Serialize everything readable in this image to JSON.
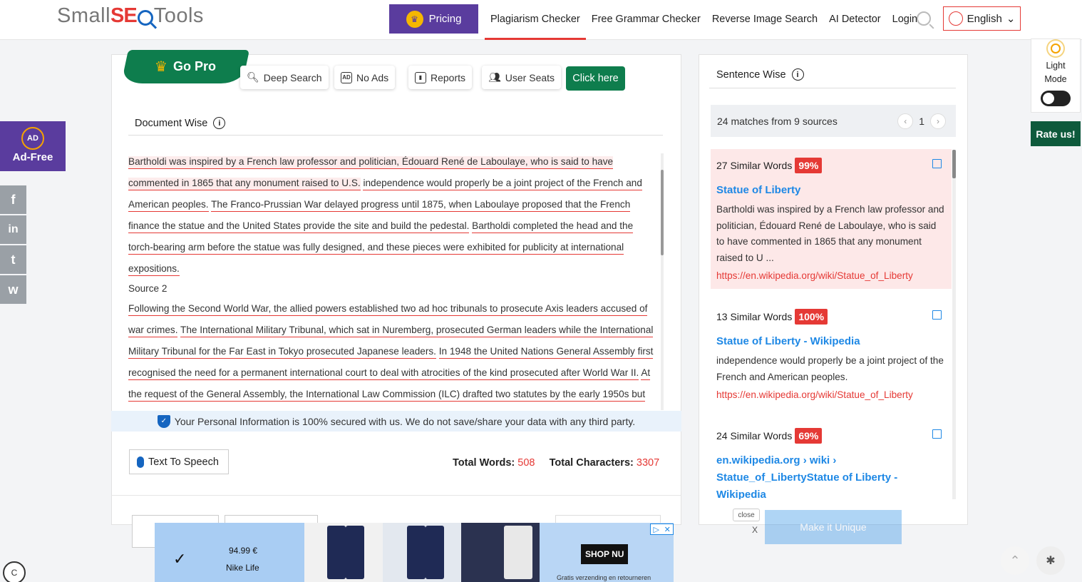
{
  "header": {
    "logo_small": "Small",
    "logo_seo": "SE",
    "logo_tools": "Tools",
    "pricing_label": "Pricing",
    "nav": [
      "Plagiarism Checker",
      "Free Grammar Checker",
      "Reverse Image Search",
      "AI Detector",
      "Login"
    ],
    "language": "English"
  },
  "pro_bar": {
    "go_pro": "Go Pro",
    "features": [
      {
        "label": "Deep Search",
        "icon": "search-icon"
      },
      {
        "label": "No Ads",
        "icon": "ad-block-icon"
      },
      {
        "label": "Reports",
        "icon": "report-icon"
      },
      {
        "label": "User Seats",
        "icon": "users-icon"
      }
    ],
    "cta": "Click here"
  },
  "document": {
    "heading": "Document Wise",
    "lines": [
      {
        "text": "Bartholdi was inspired by a French law professor and politician, Édouard René de Laboulaye, who is said to have commented in 1865 that any monument raised to U.S.",
        "type": "hl"
      },
      {
        "text": "independence would properly be a joint project of the French and American peoples.",
        "type": "u"
      },
      {
        "text": "The Franco-Prussian War delayed progress until 1875, when Laboulaye proposed that the French finance the statue and the United States provide the site and build the pedestal.",
        "type": "u"
      },
      {
        "text": "Bartholdi completed the head and the torch-bearing arm before the statue was fully designed, and these pieces were exhibited for publicity at international expositions.",
        "type": "u"
      }
    ],
    "source_label": "Source 2",
    "lines2": [
      "Following the Second World War, the allied powers established two ad hoc tribunals to prosecute Axis leaders accused of war crimes.",
      "The International Military Tribunal, which sat in Nuremberg, prosecuted German leaders while the International Military Tribunal for the Far East in Tokyo prosecuted Japanese leaders.",
      "In 1948 the United Nations General Assembly first recognised the need for a permanent international court to deal with atrocities of the kind prosecuted after World War II.",
      "At the request of the General Assembly, the International Law Commission (ILC) drafted two statutes by the early 1950s but these were shelved during the Cold War, which made the establishment of"
    ],
    "security_note": "Your Personal Information is 100% secured with us. We do not save/share your data with any third party.",
    "tts": "Text To Speech",
    "total_words_label": "Total Words:",
    "total_words": "508",
    "total_chars_label": "Total Characters:",
    "total_chars": "3307"
  },
  "sentence": {
    "heading": "Sentence Wise",
    "matches_summary": "24 matches from 9 sources",
    "page": "1",
    "matches": [
      {
        "similar": "27 Similar Words",
        "pct": "99%",
        "title": "Statue of Liberty",
        "snippet": "Bartholdi was inspired by a French law professor and politician, Édouard René de Laboulaye, who is said to have commented in 1865 that any monument raised to U ...",
        "url": "https://en.wikipedia.org/wiki/Statue_of_Liberty"
      },
      {
        "similar": "13 Similar Words",
        "pct": "100%",
        "title": "Statue of Liberty - Wikipedia",
        "snippet": "independence would properly be a joint project of the French and American peoples.",
        "url": "https://en.wikipedia.org/wiki/Statue_of_Liberty"
      },
      {
        "similar": "24 Similar Words",
        "pct": "69%",
        "title": "en.wikipedia.org › wiki › Statue_of_LibertyStatue of Liberty - Wikipedia",
        "snippet": "",
        "url": ""
      }
    ]
  },
  "side": {
    "light_mode": "Light Mode",
    "rate_us": "Rate us!",
    "ad_free": "Ad-Free",
    "ad_badge": "AD",
    "social": [
      "f",
      "in",
      "t",
      "w"
    ]
  },
  "ad": {
    "price": "94.99 €",
    "brand": "Nike Life",
    "shop": "SHOP NU",
    "shipping": "Gratis verzending en retourneren",
    "close": "close",
    "x": "X",
    "make_unique": "Make it Unique"
  },
  "colors": {
    "accent_red": "#e53935",
    "brand_green": "#0e7d4d",
    "purple": "#5a3c9e",
    "link_blue": "#1e88e5"
  }
}
